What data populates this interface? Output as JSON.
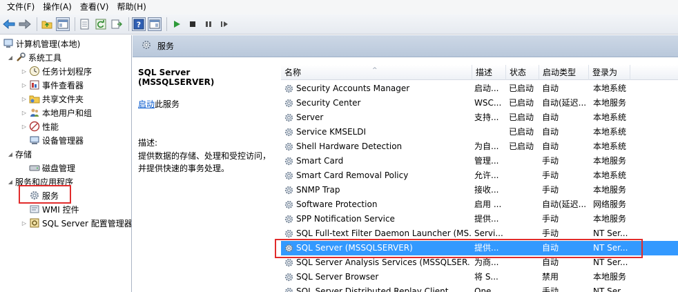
{
  "menu": [
    "文件(F)",
    "操作(A)",
    "查看(V)",
    "帮助(H)"
  ],
  "toolbar_icons": [
    "back-arrow-icon",
    "forward-arrow-icon",
    "up-folder-icon",
    "console-tree-icon",
    "export-list-icon",
    "refresh-icon",
    "properties-icon",
    "help-icon",
    "action-pane-icon",
    "play-icon",
    "stop-icon",
    "pause-icon",
    "restart-icon"
  ],
  "tree": {
    "root": "计算机管理(本地)",
    "system_tools": "系统工具",
    "task_scheduler": "任务计划程序",
    "event_viewer": "事件查看器",
    "shared_folders": "共享文件夹",
    "local_users": "本地用户和组",
    "performance": "性能",
    "device_manager": "设备管理器",
    "storage": "存储",
    "disk_management": "磁盘管理",
    "services_apps": "服务和应用程序",
    "services": "服务",
    "wmi": "WMI 控件",
    "sql_config": "SQL Server 配置管理器"
  },
  "header": {
    "title": "服务"
  },
  "description": {
    "service_name": "SQL Server (MSSQLSERVER)",
    "start_link": "启动",
    "start_suffix": "此服务",
    "desc_label": "描述:",
    "desc_text": "提供数据的存储、处理和受控访问，并提供快速的事务处理。"
  },
  "columns": [
    "名称",
    "描述",
    "状态",
    "启动类型",
    "登录为"
  ],
  "services": [
    {
      "name": "Security Accounts Manager",
      "desc": "启动...",
      "status": "已启动",
      "startup": "自动",
      "logon": "本地系统"
    },
    {
      "name": "Security Center",
      "desc": "WSC...",
      "status": "已启动",
      "startup": "自动(延迟...",
      "logon": "本地服务"
    },
    {
      "name": "Server",
      "desc": "支持...",
      "status": "已启动",
      "startup": "自动",
      "logon": "本地系统"
    },
    {
      "name": "Service KMSELDI",
      "desc": "",
      "status": "已启动",
      "startup": "自动",
      "logon": "本地系统"
    },
    {
      "name": "Shell Hardware Detection",
      "desc": "为自...",
      "status": "已启动",
      "startup": "自动",
      "logon": "本地系统"
    },
    {
      "name": "Smart Card",
      "desc": "管理...",
      "status": "",
      "startup": "手动",
      "logon": "本地服务"
    },
    {
      "name": "Smart Card Removal Policy",
      "desc": "允许...",
      "status": "",
      "startup": "手动",
      "logon": "本地系统"
    },
    {
      "name": "SNMP Trap",
      "desc": "接收...",
      "status": "",
      "startup": "手动",
      "logon": "本地服务"
    },
    {
      "name": "Software Protection",
      "desc": "启用 ...",
      "status": "",
      "startup": "自动(延迟...",
      "logon": "网络服务"
    },
    {
      "name": "SPP Notification Service",
      "desc": "提供...",
      "status": "",
      "startup": "手动",
      "logon": "本地服务"
    },
    {
      "name": "SQL Full-text Filter Daemon Launcher (MS...",
      "desc": "Servi...",
      "status": "",
      "startup": "手动",
      "logon": "NT Ser..."
    },
    {
      "name": "SQL Server (MSSQLSERVER)",
      "desc": "提供...",
      "status": "",
      "startup": "自动",
      "logon": "NT Ser..."
    },
    {
      "name": "SQL Server Analysis Services (MSSQLSER...",
      "desc": "为商...",
      "status": "",
      "startup": "自动",
      "logon": "NT Ser..."
    },
    {
      "name": "SQL Server Browser",
      "desc": "将 S...",
      "status": "",
      "startup": "禁用",
      "logon": "本地服务"
    },
    {
      "name": "SQL Server Distributed Replay Client",
      "desc": "One...",
      "status": "",
      "startup": "手动",
      "logon": "NT Ser..."
    }
  ],
  "selected_index": 11
}
